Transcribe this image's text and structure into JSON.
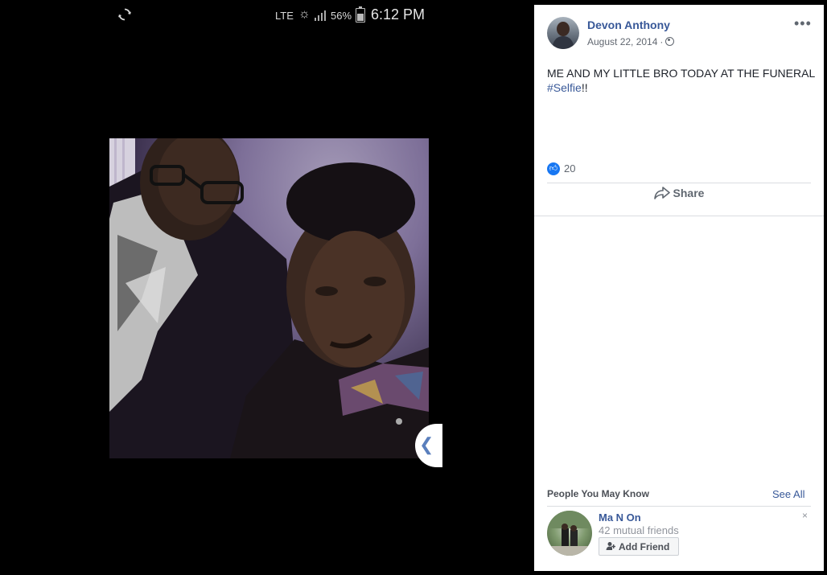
{
  "status_bar": {
    "network": "LTE",
    "battery": "56%",
    "time": "6:12 PM",
    "icons": [
      "sync-icon",
      "brightness-icon",
      "signal-icon",
      "battery-icon"
    ]
  },
  "photo": {
    "prev_icon": "chevron-left-icon"
  },
  "post": {
    "author": "Devon Anthony",
    "date": "August 22, 2014",
    "separator": "·",
    "privacy_icon": "globe-icon",
    "more_label": "•••",
    "text_main": "ME AND MY LITTLE BRO TODAY AT THE FUNERAL",
    "hashtag": "#Selfie",
    "text_suffix": "!!",
    "like_count": "20",
    "share_label": "Share"
  },
  "pymk": {
    "title": "People You May Know",
    "see_all": "See All",
    "person": {
      "name": "Ma N On",
      "mutual": "42 mutual friends",
      "add_label": "Add Friend",
      "dismiss": "×"
    }
  },
  "colors": {
    "link": "#385898",
    "like": "#1877f2"
  }
}
